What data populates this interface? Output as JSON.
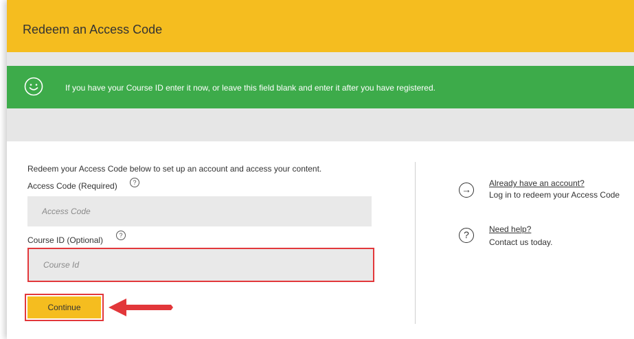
{
  "header": {
    "title": "Redeem an Access Code"
  },
  "banner": {
    "icon": "smiley-icon",
    "text": "If you have your Course ID enter it now, or leave this field blank and enter it after you have registered."
  },
  "form": {
    "intro": "Redeem your Access Code below to set up an account and access your content.",
    "access_code_label": "Access Code (Required)",
    "access_code_placeholder": "Access Code",
    "access_code_value": "",
    "course_id_label": "Course ID (Optional)",
    "course_id_placeholder": "Course Id",
    "course_id_value": "",
    "continue_label": "Continue"
  },
  "sidebar": {
    "account_link": "Already have an account?",
    "account_text": "Log in to redeem your Access Code",
    "help_link": "Need help?",
    "help_text": "Contact us today."
  },
  "colors": {
    "header": "#f5bd1f",
    "banner": "#3dab4a",
    "highlight": "#e2373a"
  }
}
